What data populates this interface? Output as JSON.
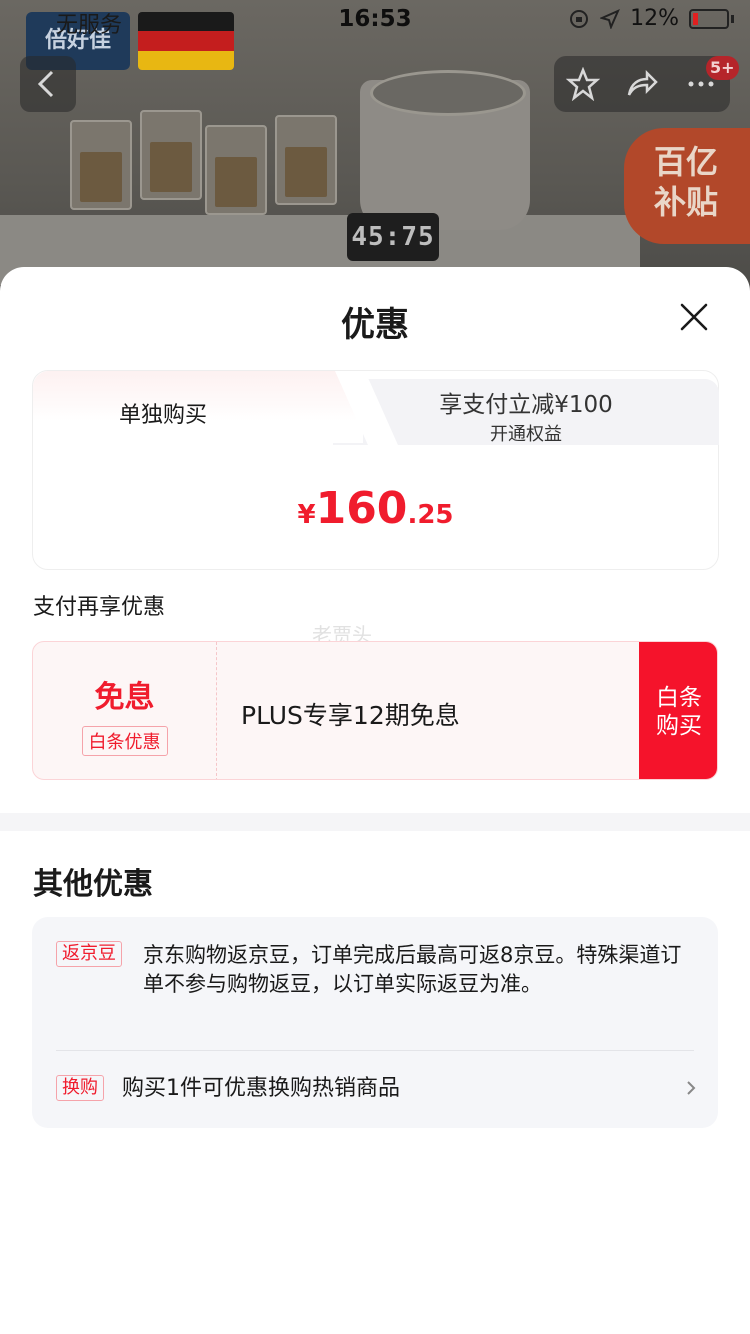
{
  "status_bar": {
    "carrier": "无服务",
    "time": "16:53",
    "battery": "12%"
  },
  "background": {
    "store_logo": "倍好佳",
    "display": "45:75",
    "subsidy_line1": "百亿",
    "subsidy_line2": "补贴",
    "notification_badge": "5+"
  },
  "sheet": {
    "title": "优惠",
    "tab_single": "单独购买",
    "tab_member_line1": "享支付立减¥100",
    "tab_member_line2": "开通权益",
    "price_currency": "¥",
    "price_int": "160",
    "price_dec": ".25",
    "pay_title": "支付再享优惠",
    "baitiao": {
      "headline": "免息",
      "tag": "白条优惠",
      "description": "PLUS专享12期免息",
      "button_line1": "白条",
      "button_line2": "购买"
    },
    "other_title": "其他优惠",
    "other_items": [
      {
        "tag": "返京豆",
        "text": "京东购物返京豆，订单完成后最高可返8京豆。特殊渠道订单不参与购物返豆，以订单实际返豆为准。"
      },
      {
        "tag": "换购",
        "text": "购买1件可优惠换购热销商品"
      }
    ],
    "watermark": "老贾头"
  },
  "colors": {
    "accent_red": "#f01c2d",
    "button_red": "#f5132b",
    "card_bg": "#f5f6f9"
  }
}
